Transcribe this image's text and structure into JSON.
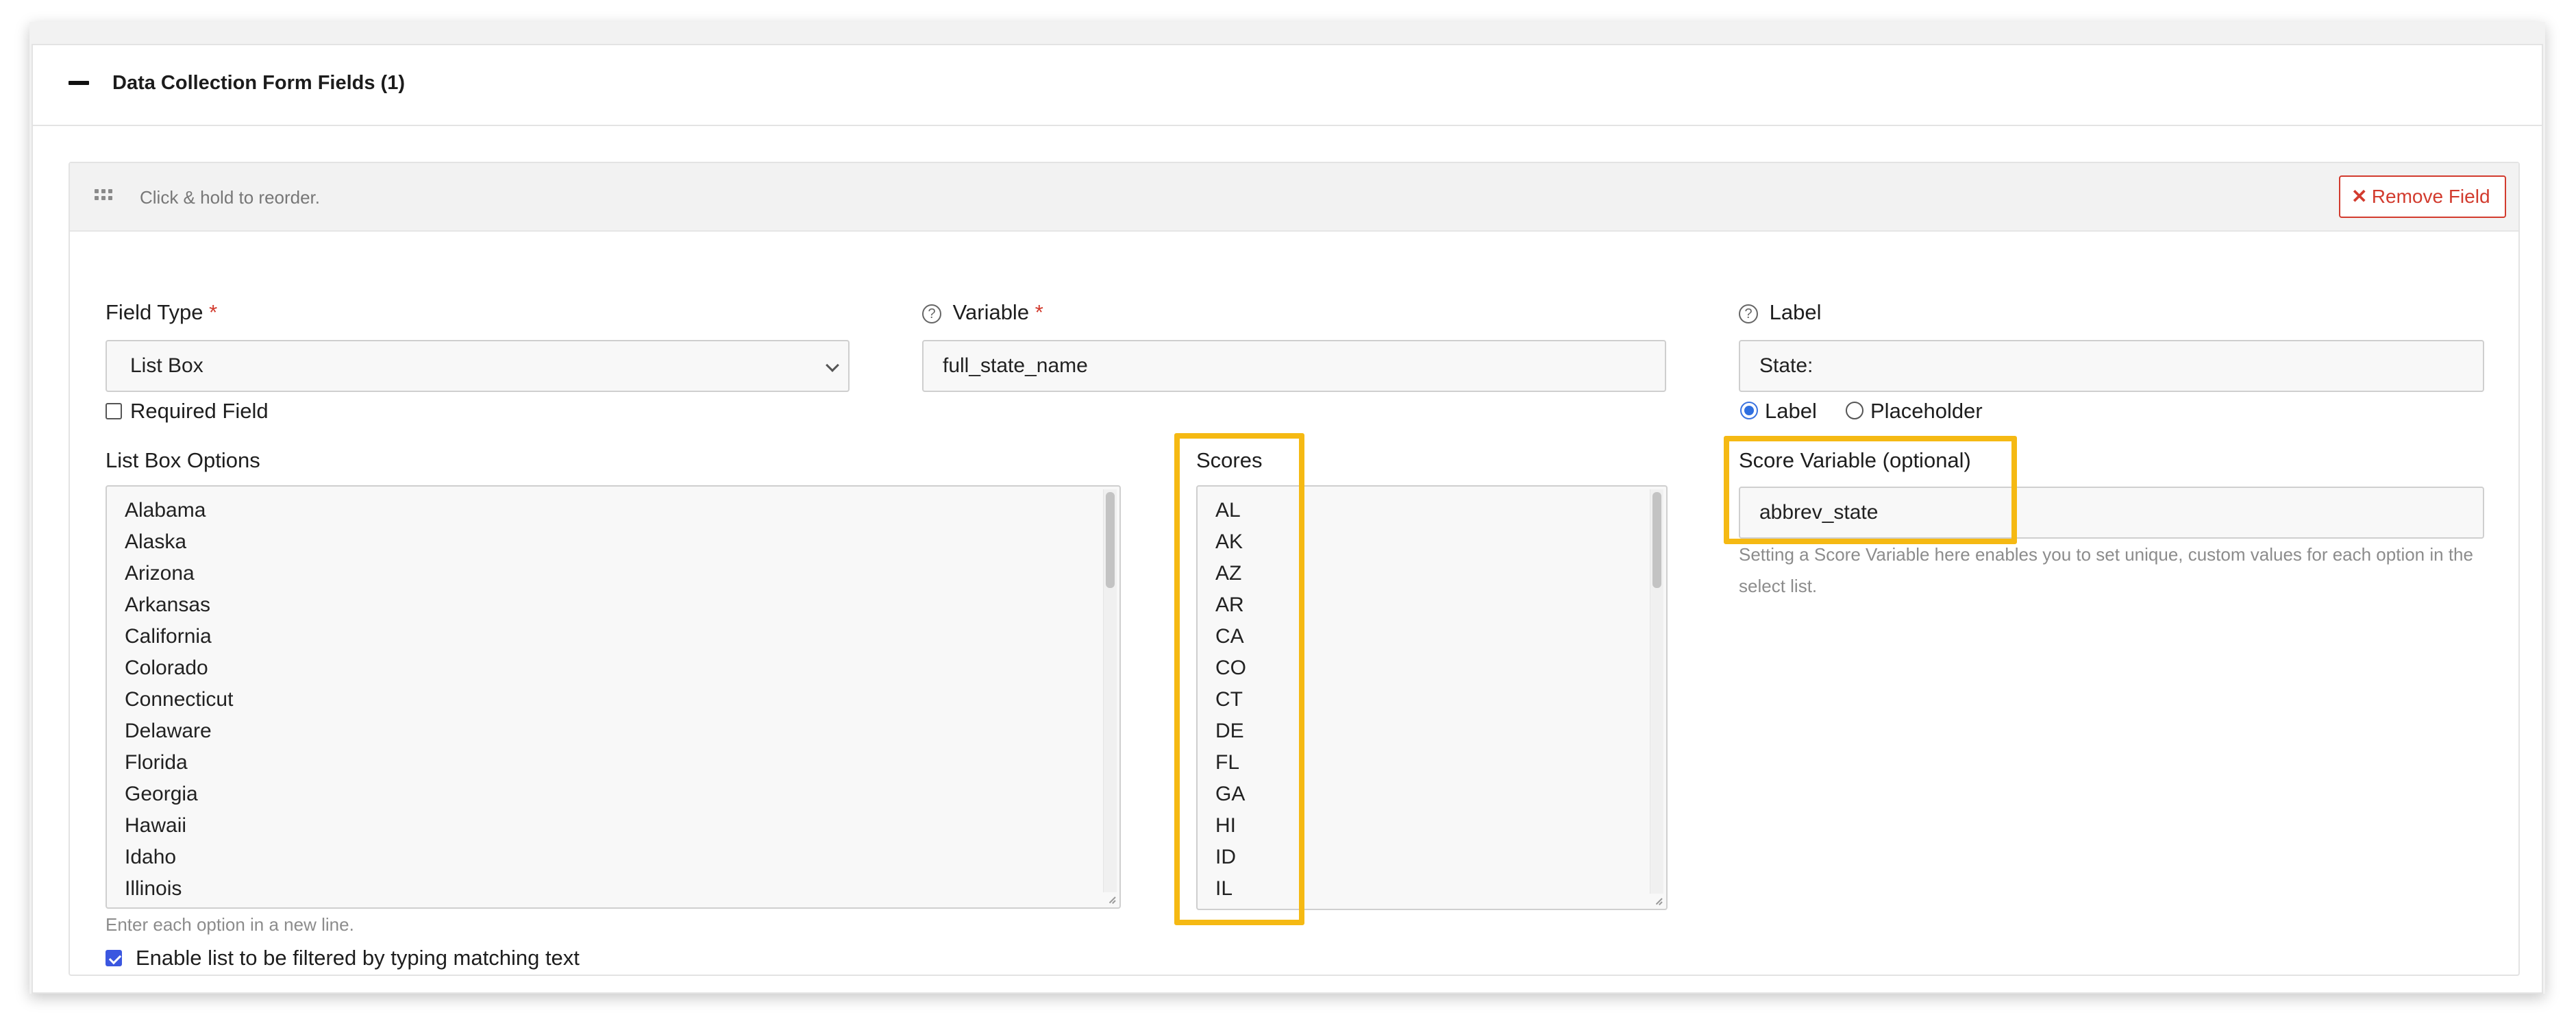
{
  "panel": {
    "title": "Data Collection Form Fields (1)"
  },
  "field": {
    "reorder_hint": "Click & hold to reorder.",
    "remove_label": "Remove Field",
    "field_type": {
      "label": "Field Type",
      "required_marker": "*",
      "value": "List Box"
    },
    "required_field": {
      "label": "Required Field",
      "checked": false
    },
    "variable": {
      "label": "Variable",
      "required_marker": "*",
      "value": "full_state_name"
    },
    "label_field": {
      "label": "Label",
      "value": "State:"
    },
    "label_mode": {
      "options": [
        "Label",
        "Placeholder"
      ],
      "selected": "Label"
    },
    "list_box_options": {
      "label": "List Box Options",
      "items": [
        "Alabama",
        "Alaska",
        "Arizona",
        "Arkansas",
        "California",
        "Colorado",
        "Connecticut",
        "Delaware",
        "Florida",
        "Georgia",
        "Hawaii",
        "Idaho",
        "Illinois"
      ],
      "hint": "Enter each option in a new line."
    },
    "scores": {
      "label": "Scores",
      "items": [
        "AL",
        "AK",
        "AZ",
        "AR",
        "CA",
        "CO",
        "CT",
        "DE",
        "FL",
        "GA",
        "HI",
        "ID",
        "IL"
      ]
    },
    "score_variable": {
      "label": "Score Variable (optional)",
      "value": "abbrev_state",
      "help_line1": "Setting a Score Variable here enables you to set unique, custom values for each option in the",
      "help_line2": "select list."
    },
    "filter_option": {
      "label": "Enable list to be filtered by typing matching text",
      "checked": true
    }
  },
  "colors": {
    "highlight": "#f5b913",
    "danger": "#d23b2e",
    "accent": "#3b57e0"
  },
  "icons": {
    "collapse": "minus-icon",
    "grip": "grip-icon",
    "remove": "close-icon",
    "help": "question-circle-icon"
  }
}
